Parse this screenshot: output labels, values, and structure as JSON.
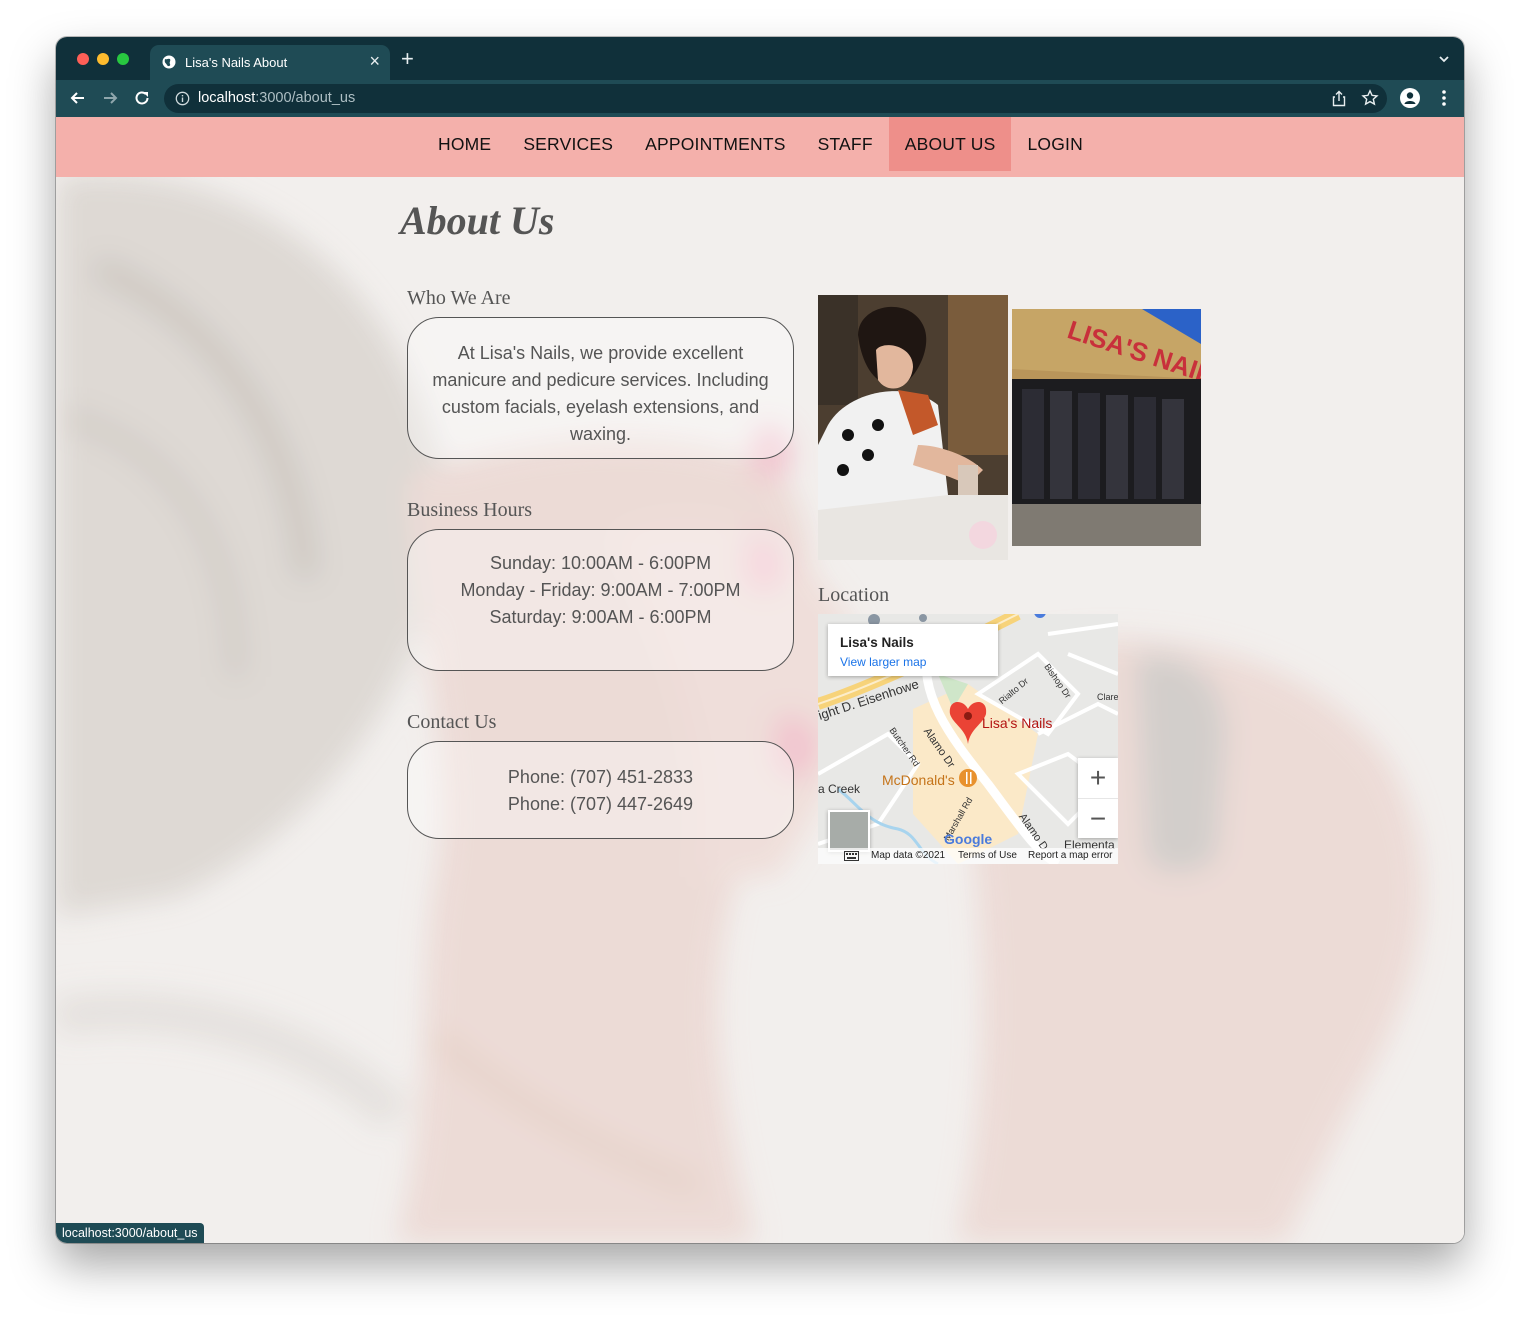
{
  "browser": {
    "tab_title": "Lisa's Nails About",
    "new_tab": "+",
    "close": "×",
    "url_host": "localhost",
    "url_path": ":3000/about_us",
    "status_url": "localhost:3000/about_us"
  },
  "nav": {
    "items": [
      "HOME",
      "SERVICES",
      "APPOINTMENTS",
      "STAFF",
      "ABOUT US",
      "LOGIN"
    ],
    "active": "ABOUT US"
  },
  "page": {
    "title": "About Us",
    "who": {
      "heading": "Who We Are",
      "text": "At Lisa's Nails, we provide excellent manicure and pedicure services. Including custom facials, eyelash extensions, and waxing."
    },
    "hours": {
      "heading": "Business Hours",
      "lines": [
        "Sunday: 10:00AM - 6:00PM",
        "Monday - Friday: 9:00AM - 7:00PM",
        "Saturday: 9:00AM - 6:00PM"
      ]
    },
    "contact": {
      "heading": "Contact Us",
      "lines": [
        "Phone: (707) 451-2833",
        "Phone: (707) 447-2649"
      ]
    },
    "location_heading": "Location"
  },
  "map": {
    "place_name": "Lisa's Nails",
    "larger_map": "View larger map",
    "pin_label": "Lisa's Nails",
    "poi_label": "McDonald's",
    "streets": [
      "ight D. Eisenhowe",
      "Alamo Dr",
      "Butcher Rd",
      "Marshall Rd",
      "Rialto Dr",
      "Bishop Dr",
      "Clare",
      "Alamo D",
      "a Creek",
      "Elementa"
    ],
    "zoom_in": "+",
    "zoom_out": "−",
    "logo": "Google",
    "map_data": "Map data ©2021",
    "terms": "Terms of Use",
    "report": "Report a map error"
  },
  "colors": {
    "nav_bg": "#f4b0ab",
    "nav_active": "#ee8f8a",
    "chrome_dark": "#10303a",
    "chrome_tab": "#1f4b55"
  },
  "icons": [
    "globe-icon",
    "close-icon",
    "plus-icon",
    "chevron-down-icon",
    "back-icon",
    "forward-icon",
    "reload-icon",
    "info-icon",
    "share-icon",
    "star-icon",
    "profile-icon",
    "menu-icon",
    "map-pin-icon",
    "restaurant-icon",
    "keyboard-icon"
  ]
}
